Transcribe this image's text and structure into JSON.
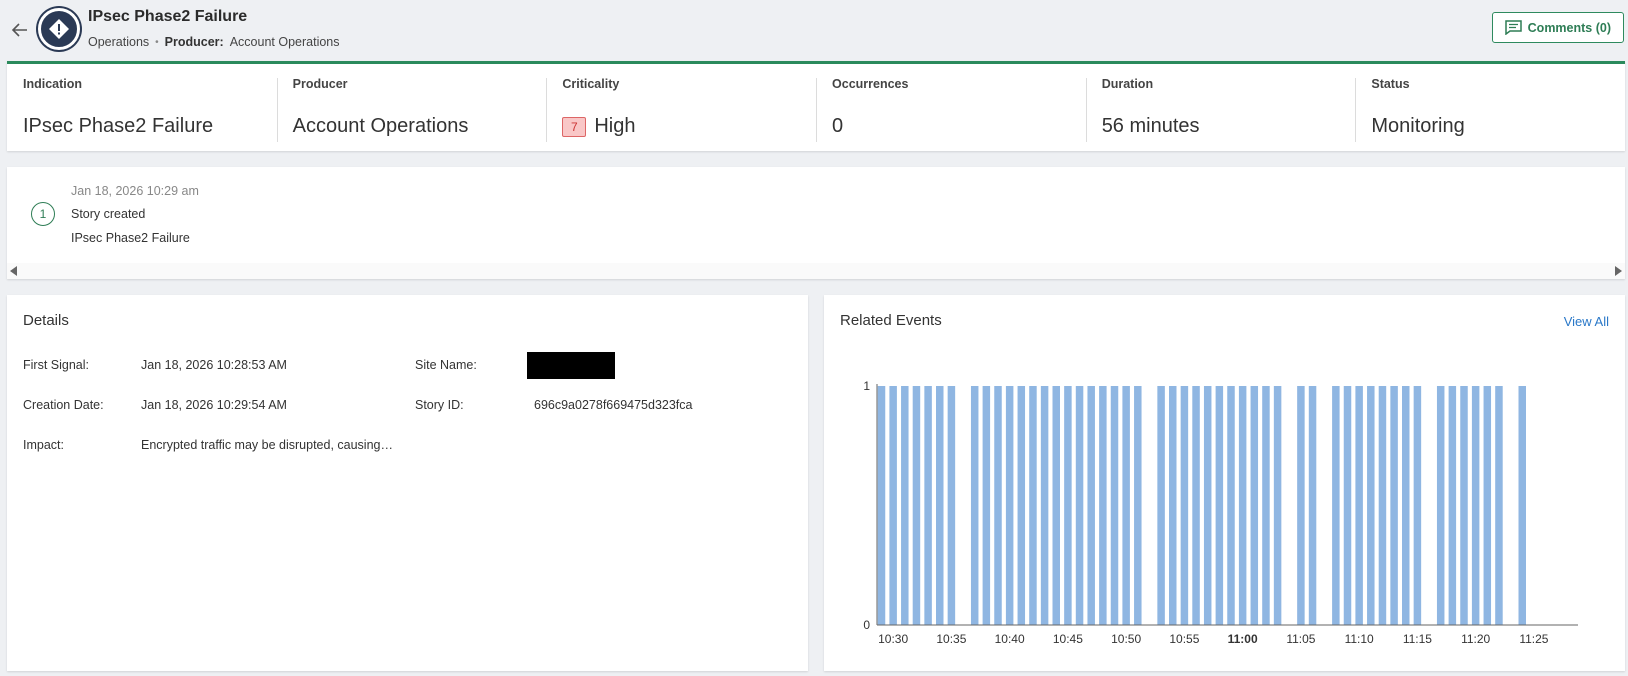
{
  "header": {
    "title": "IPsec Phase2 Failure",
    "breadcrumb_category": "Operations",
    "breadcrumb_producer_label": "Producer:",
    "breadcrumb_producer_value": "Account Operations",
    "comments_label": "Comments (0)"
  },
  "summary": [
    {
      "label": "Indication",
      "value": "IPsec Phase2 Failure"
    },
    {
      "label": "Producer",
      "value": "Account Operations"
    },
    {
      "label": "Criticality",
      "value": "High",
      "badge": "7"
    },
    {
      "label": "Occurrences",
      "value": "0"
    },
    {
      "label": "Duration",
      "value": "56 minutes"
    },
    {
      "label": "Status",
      "value": "Monitoring"
    }
  ],
  "timeline": {
    "step": "1",
    "date": "Jan 18, 2026 10:29 am",
    "event": "Story created",
    "subtitle": "IPsec Phase2 Failure"
  },
  "details": {
    "title": "Details",
    "first_signal_label": "First Signal:",
    "first_signal_value": "Jan 18, 2026 10:28:53 AM",
    "creation_date_label": "Creation Date:",
    "creation_date_value": "Jan 18, 2026 10:29:54 AM",
    "impact_label": "Impact:",
    "impact_value": "Encrypted traffic may be disrupted, causing…",
    "site_name_label": "Site Name:",
    "story_id_label": "Story ID:",
    "story_id_value": "696c9a0278f669475d323fca"
  },
  "related": {
    "title": "Related Events",
    "view_all_label": "View All"
  },
  "colors": {
    "accent_green": "#2a8a5c",
    "bar_blue": "#8fb6e2",
    "link_blue": "#2a78c8",
    "critical_red": "#f9c7c7"
  },
  "chart_data": {
    "type": "bar",
    "title": "",
    "xlabel": "",
    "ylabel": "",
    "ylim": [
      0,
      1
    ],
    "y_ticks": [
      "0",
      "1"
    ],
    "x_ticks": [
      "10:30",
      "10:35",
      "10:40",
      "10:45",
      "10:50",
      "10:55",
      "11:00",
      "11:05",
      "11:10",
      "11:15",
      "11:20",
      "11:25"
    ],
    "x_tick_bold": "11:00",
    "x_start_minute": 29,
    "bucket_minutes": 1,
    "values": [
      1,
      1,
      1,
      1,
      1,
      1,
      1,
      0,
      1,
      1,
      1,
      1,
      1,
      1,
      1,
      1,
      1,
      1,
      1,
      1,
      1,
      1,
      1,
      0,
      1,
      1,
      1,
      1,
      1,
      1,
      1,
      1,
      1,
      1,
      1,
      0,
      1,
      1,
      0,
      1,
      1,
      1,
      1,
      1,
      1,
      1,
      1,
      0,
      1,
      1,
      1,
      1,
      1,
      1,
      0,
      1
    ]
  }
}
